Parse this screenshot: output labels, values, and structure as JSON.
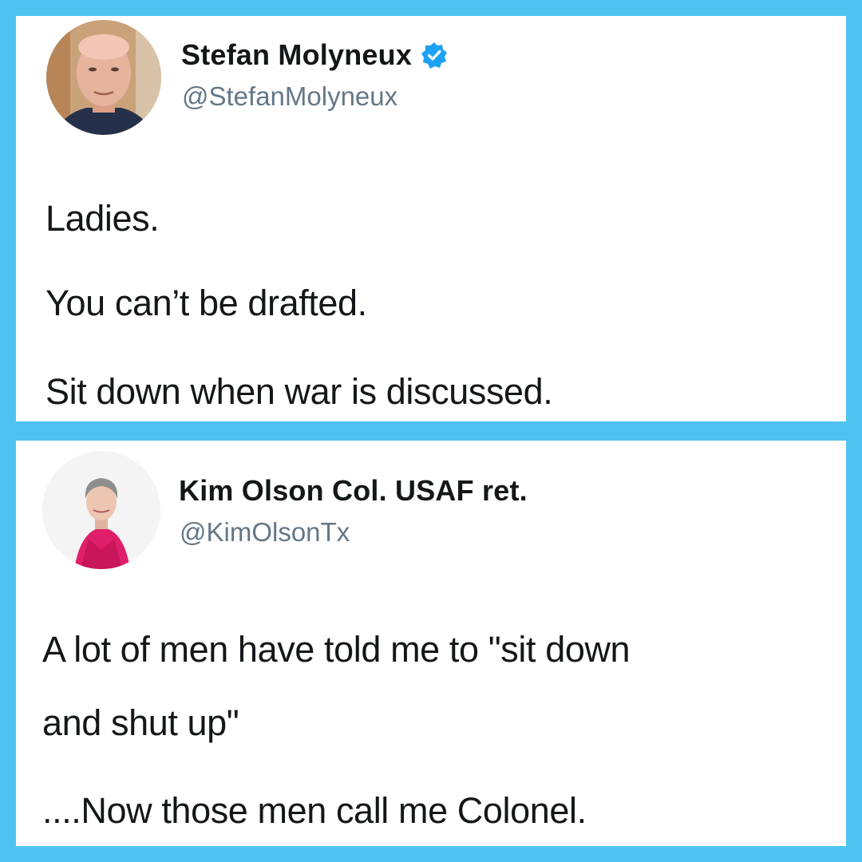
{
  "tweets": [
    {
      "display_name": "Stefan Molyneux",
      "handle": "@StefanMolyneux",
      "verified": true,
      "text_lines": [
        "Ladies.",
        "You can’t be drafted.",
        "Sit down when war is discussed."
      ]
    },
    {
      "display_name": "Kim Olson Col. USAF ret.",
      "handle": "@KimOlsonTx",
      "verified": false,
      "text_lines": [
        "A lot of men have told me to \"sit down",
        "and shut up\"",
        "....Now those men call me Colonel."
      ]
    }
  ],
  "colors": {
    "background_frame": "#4ec3ef",
    "panel": "#ffffff",
    "name_text": "#14171a",
    "handle_text": "#657786",
    "verified_badge": "#1da1f2"
  },
  "icons": {
    "verified": "verified-badge-icon",
    "avatar_1": "man-portrait-avatar",
    "avatar_2": "woman-portrait-avatar"
  }
}
